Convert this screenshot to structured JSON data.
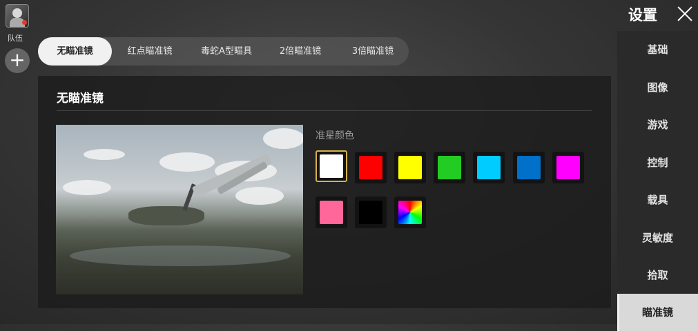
{
  "team": {
    "label": "队伍",
    "add_symbol": "+"
  },
  "tabs": [
    {
      "label": "无瞄准镜",
      "active": true
    },
    {
      "label": "红点瞄准镜",
      "active": false
    },
    {
      "label": "毒蛇A型瞄具",
      "active": false
    },
    {
      "label": "2倍瞄准镜",
      "active": false
    },
    {
      "label": "3倍瞄准镜",
      "active": false
    }
  ],
  "panel": {
    "title": "无瞄准镜",
    "color_label": "准星颜色",
    "selected_color": "#ffffff",
    "colors": [
      "#ffffff",
      "#ff0000",
      "#ffff00",
      "#22cc22",
      "#00ccff",
      "#0070c8",
      "#ff00ff",
      "#ff6699",
      "#000000",
      "rainbow"
    ]
  },
  "settings": {
    "title": "设置",
    "nav": [
      {
        "label": "基础",
        "active": false
      },
      {
        "label": "图像",
        "active": false
      },
      {
        "label": "游戏",
        "active": false
      },
      {
        "label": "控制",
        "active": false
      },
      {
        "label": "载具",
        "active": false
      },
      {
        "label": "灵敏度",
        "active": false
      },
      {
        "label": "拾取",
        "active": false
      },
      {
        "label": "瞄准镜",
        "active": true
      }
    ]
  },
  "icons": {
    "avatar": "player-avatar-icon",
    "add": "plus-icon",
    "close": "close-icon"
  }
}
